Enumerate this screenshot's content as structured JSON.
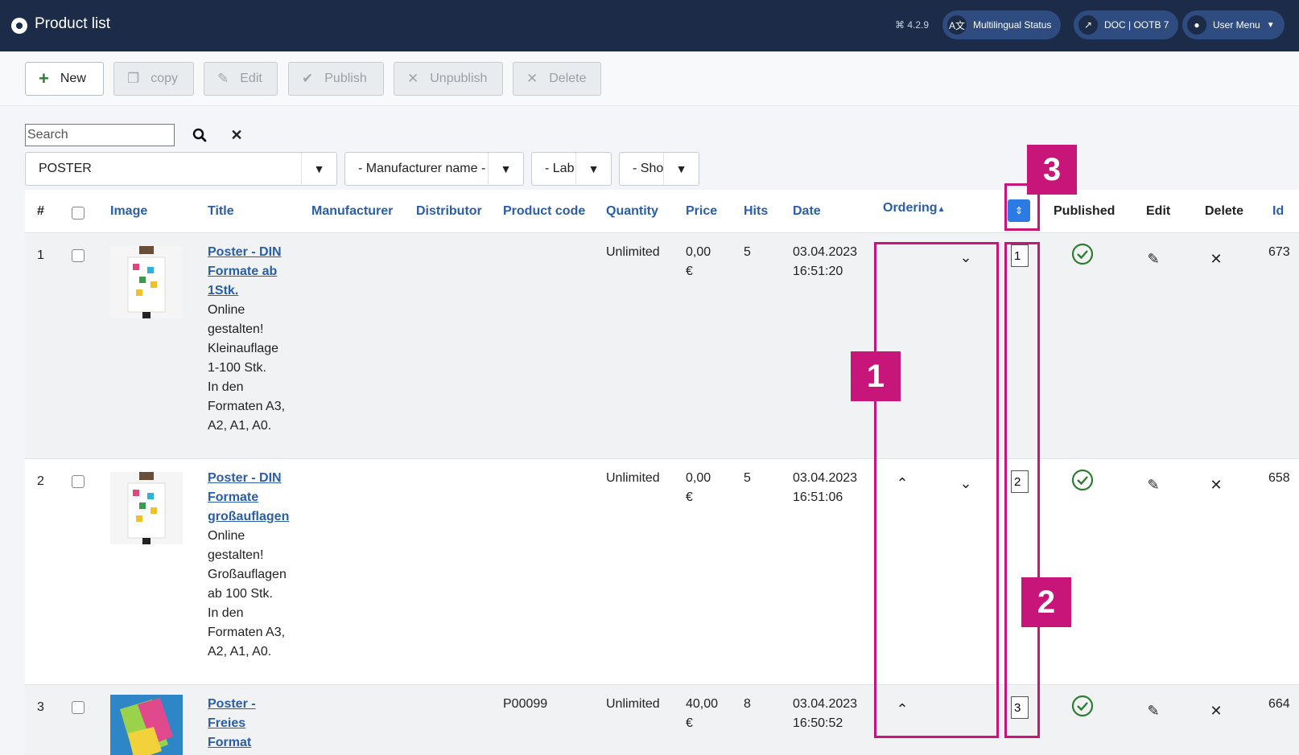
{
  "header": {
    "title": "Product list",
    "version": "4.2.9",
    "buttons": [
      {
        "label": "Multilingual Status",
        "icon": "language-icon"
      },
      {
        "label": "DOC | OOTB 7",
        "icon": "external-link-icon"
      },
      {
        "label": "User Menu",
        "icon": "user-icon"
      }
    ]
  },
  "toolbar": {
    "new_label": "New",
    "copy_label": "copy",
    "edit_label": "Edit",
    "publish_label": "Publish",
    "unpublish_label": "Unpublish",
    "delete_label": "Delete"
  },
  "filters": {
    "search_placeholder": "Search",
    "category": "POSTER",
    "manufacturer": "- Manufacturer name -",
    "label": "- Lab",
    "show": "- Sho"
  },
  "table": {
    "headers": {
      "num": "#",
      "image": "Image",
      "title": "Title",
      "manufacturer": "Manufacturer",
      "distributor": "Distributor",
      "product_code": "Product code",
      "quantity": "Quantity",
      "price": "Price",
      "hits": "Hits",
      "date": "Date",
      "ordering": "Ordering",
      "published": "Published",
      "edit": "Edit",
      "delete": "Delete",
      "id": "Id"
    },
    "rows": [
      {
        "num": "1",
        "title_lines": [
          "Poster - DIN",
          "Formate ab",
          "1Stk."
        ],
        "desc_lines": [
          "Online",
          "gestalten!",
          "Kleinauflage",
          "1-100 Stk.",
          "In den",
          "Formaten A3,",
          "A2, A1, A0."
        ],
        "product_code": "",
        "quantity": "Unlimited",
        "price_line1": "0,00",
        "price_line2": "€",
        "hits": "5",
        "date_line1": "03.04.2023",
        "date_line2": "16:51:20",
        "order_value": "1",
        "id": "673"
      },
      {
        "num": "2",
        "title_lines": [
          "Poster - DIN",
          "Formate",
          "großauflagen"
        ],
        "desc_lines": [
          "Online",
          "gestalten!",
          "Großauflagen",
          "ab 100 Stk.",
          "In den",
          "Formaten A3,",
          "A2, A1, A0."
        ],
        "product_code": "",
        "quantity": "Unlimited",
        "price_line1": "0,00",
        "price_line2": "€",
        "hits": "5",
        "date_line1": "03.04.2023",
        "date_line2": "16:51:06",
        "order_value": "2",
        "id": "658"
      },
      {
        "num": "3",
        "title_lines": [
          "Poster -",
          "Freies",
          "Format"
        ],
        "desc_lines": [],
        "product_code": "P00099",
        "quantity": "Unlimited",
        "price_line1": "40,00",
        "price_line2": "€",
        "hits": "8",
        "date_line1": "03.04.2023",
        "date_line2": "16:50:52",
        "order_value": "3",
        "id": "664"
      }
    ]
  },
  "annotations": {
    "badge1": "1",
    "badge2": "2",
    "badge3": "3",
    "color": "#c8157a"
  },
  "colors": {
    "header_bg": "#1c2b48",
    "link": "#2a5ea8",
    "published_green": "#2e7d32",
    "sort_button": "#2c7be5"
  }
}
